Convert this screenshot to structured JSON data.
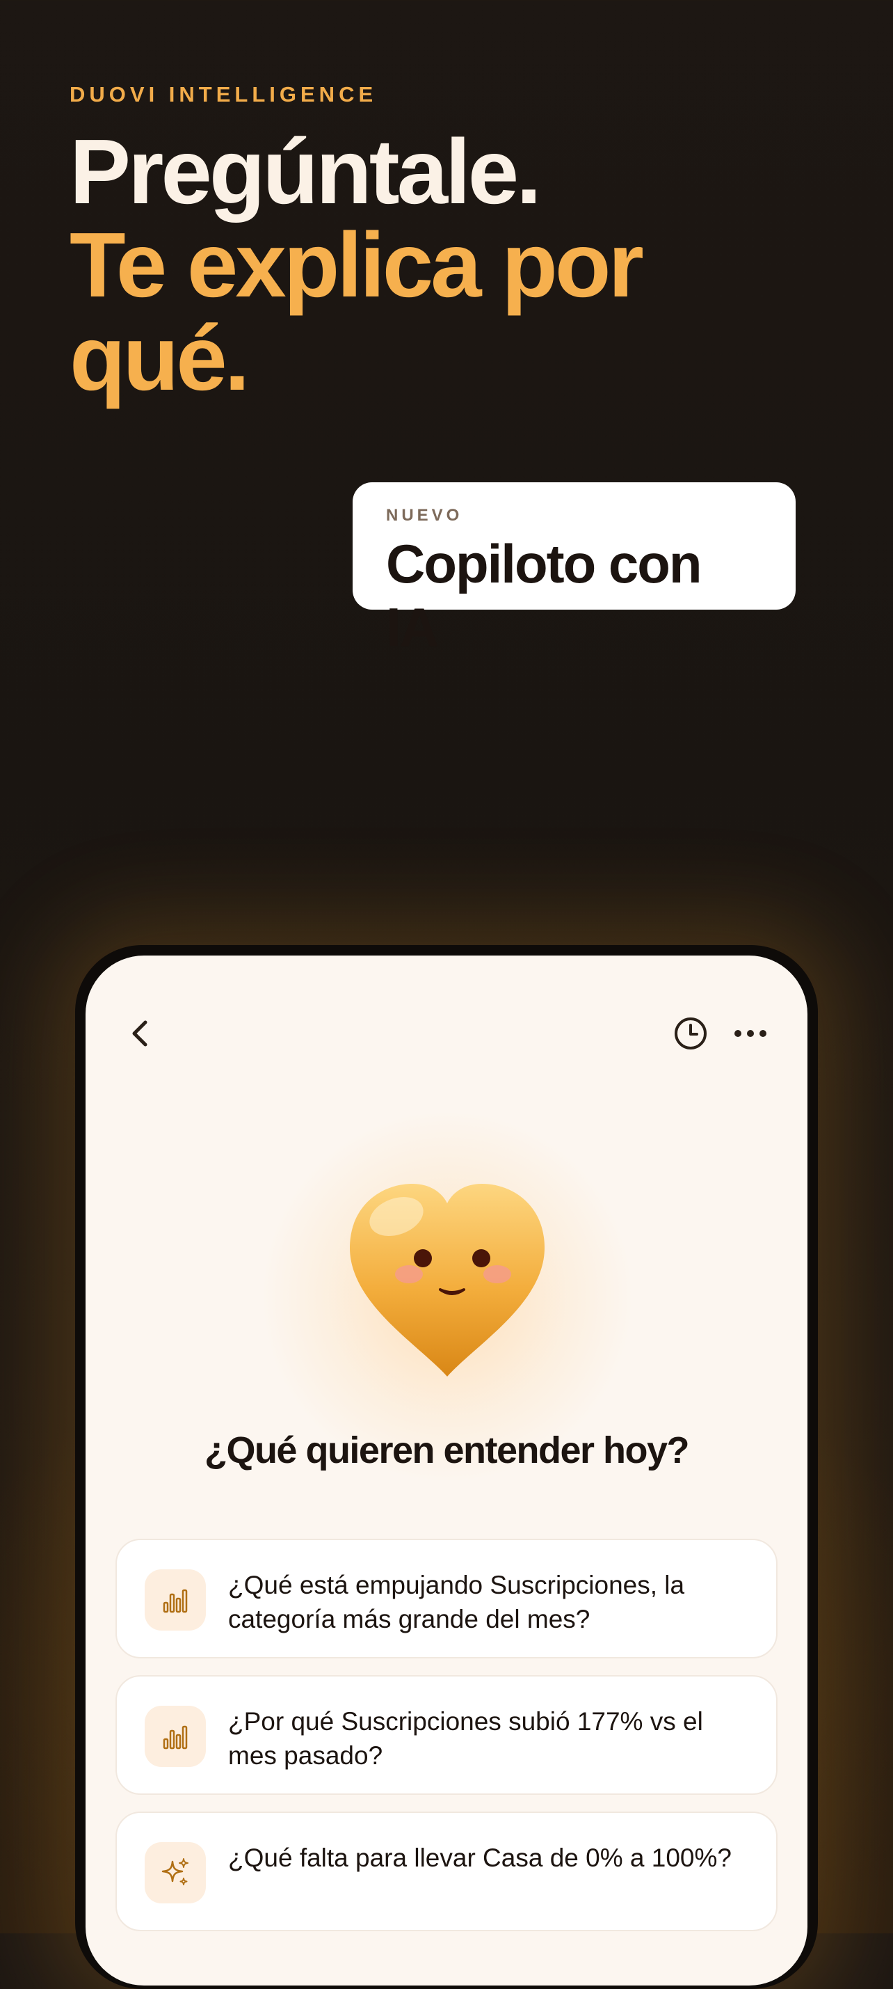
{
  "hero": {
    "eyebrow": "DUOVI INTELLIGENCE",
    "headline_line1": "Pregúntale.",
    "headline_line2": "Te explica por qué."
  },
  "badge": {
    "tag": "NUEVO",
    "title": "Copiloto con IA"
  },
  "app": {
    "nav": {
      "back_icon": "chevron-left-icon",
      "history_icon": "clock-icon",
      "more_icon": "ellipsis-icon"
    },
    "mascot_icon": "heart-mascot-icon",
    "question_title": "¿Qué quieren entender hoy?",
    "suggestions": [
      {
        "icon": "bar-chart-icon",
        "text": "¿Qué está empujando Suscripciones, la categoría más grande del mes?"
      },
      {
        "icon": "bar-chart-icon",
        "text": "¿Por qué Suscripciones subió 177% vs el mes pasado?"
      },
      {
        "icon": "sparkles-icon",
        "text": "¿Qué falta para llevar Casa  de 0% a 100%?"
      }
    ]
  },
  "colors": {
    "accent": "#f6b04e",
    "background": "#1a1511",
    "screen": "#fcf6f0",
    "text_dark": "#1c1410"
  }
}
